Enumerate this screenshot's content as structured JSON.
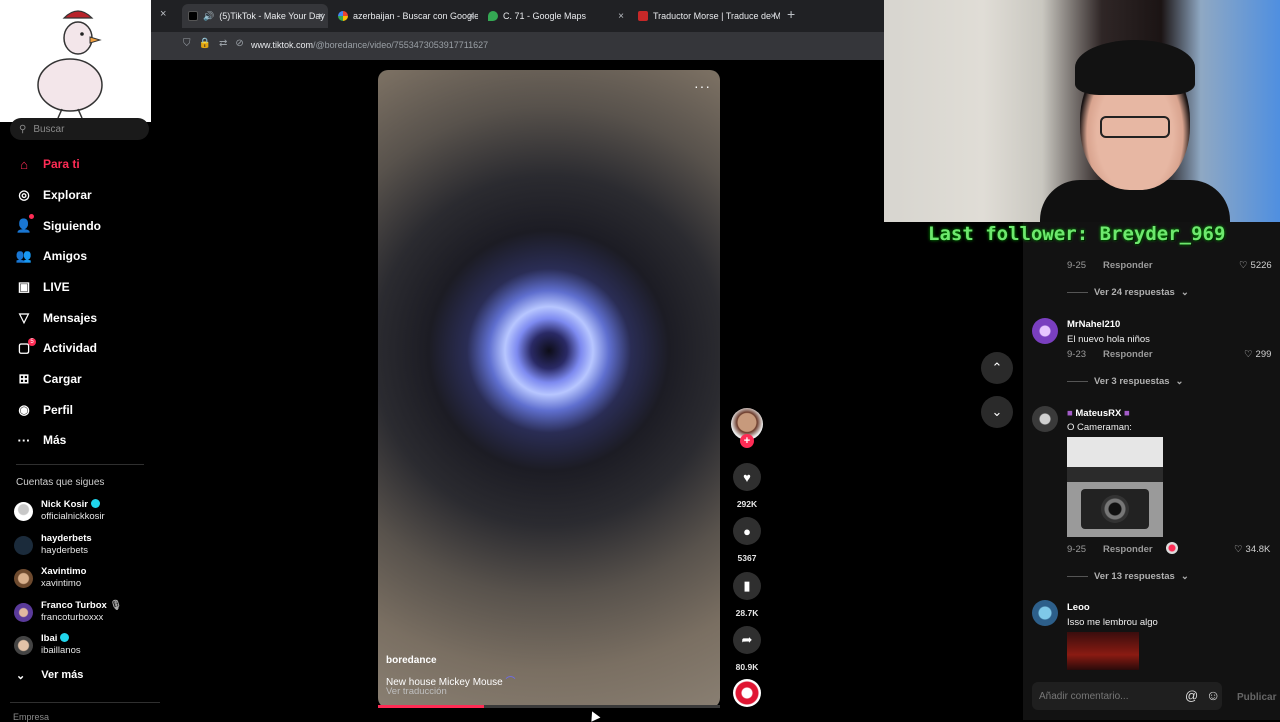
{
  "browser": {
    "tabs": [
      {
        "label": "(5)TikTok - Make Your Day",
        "active": true
      },
      {
        "label": "azerbaijan - Buscar con Google",
        "active": false
      },
      {
        "label": "C. 71 - Google Maps",
        "active": false
      },
      {
        "label": "Traductor Morse | Traduce de M",
        "active": false
      }
    ],
    "close_all": "×",
    "new_tab": "+",
    "url_host": "www.tiktok.com",
    "url_path": "/@boredance/video/7553473053917711627"
  },
  "sidebar": {
    "search_placeholder": "Buscar",
    "nav": [
      {
        "label": "Para ti",
        "icon": "home-icon",
        "active": true
      },
      {
        "label": "Explorar",
        "icon": "compass-icon"
      },
      {
        "label": "Siguiendo",
        "icon": "following-icon"
      },
      {
        "label": "Amigos",
        "icon": "friends-icon"
      },
      {
        "label": "LIVE",
        "icon": "live-icon"
      },
      {
        "label": "Mensajes",
        "icon": "messages-icon"
      },
      {
        "label": "Actividad",
        "icon": "activity-icon",
        "badge": "5"
      },
      {
        "label": "Cargar",
        "icon": "upload-icon"
      },
      {
        "label": "Perfil",
        "icon": "profile-icon"
      },
      {
        "label": "Más",
        "icon": "more-icon"
      }
    ],
    "following_title": "Cuentas que sigues",
    "accounts": [
      {
        "name": "Nick Kosir",
        "handle": "officialnickkosir",
        "verified": true
      },
      {
        "name": "hayderbets",
        "handle": "hayderbets"
      },
      {
        "name": "Xavintimo",
        "handle": "xavintimo"
      },
      {
        "name": "Franco Turbox",
        "handle": "francoturboxxx"
      },
      {
        "name": "Ibai",
        "handle": "ibaillanos",
        "verified": true
      }
    ],
    "see_more": "Ver más",
    "footer": "Empresa"
  },
  "video": {
    "author": "boredance",
    "description": "New house Mickey Mouse",
    "translate": "Ver traducción",
    "progress": 0.31,
    "likes": "292K",
    "comments": "5367",
    "saves": "28.7K",
    "shares": "80.9K"
  },
  "overlay": {
    "last_follower": "Last follower: Breyder_969"
  },
  "comments": {
    "top": {
      "date": "9-25",
      "reply": "Responder",
      "likes": "5226",
      "more": "Ver 24 respuestas"
    },
    "items": [
      {
        "user": "MrNahel210",
        "text": "El nuevo hola niños",
        "date": "9-23",
        "reply": "Responder",
        "likes": "299",
        "more": "Ver 3 respuestas"
      },
      {
        "user": "MateusRX",
        "text": "O Cameraman:",
        "date": "9-25",
        "reply": "Responder",
        "likes": "34.8K",
        "more": "Ver 13 respuestas"
      },
      {
        "user": "Leoo",
        "text": "Isso me lembrou algo"
      }
    ],
    "input_placeholder": "Añadir comentario...",
    "publish": "Publicar"
  }
}
